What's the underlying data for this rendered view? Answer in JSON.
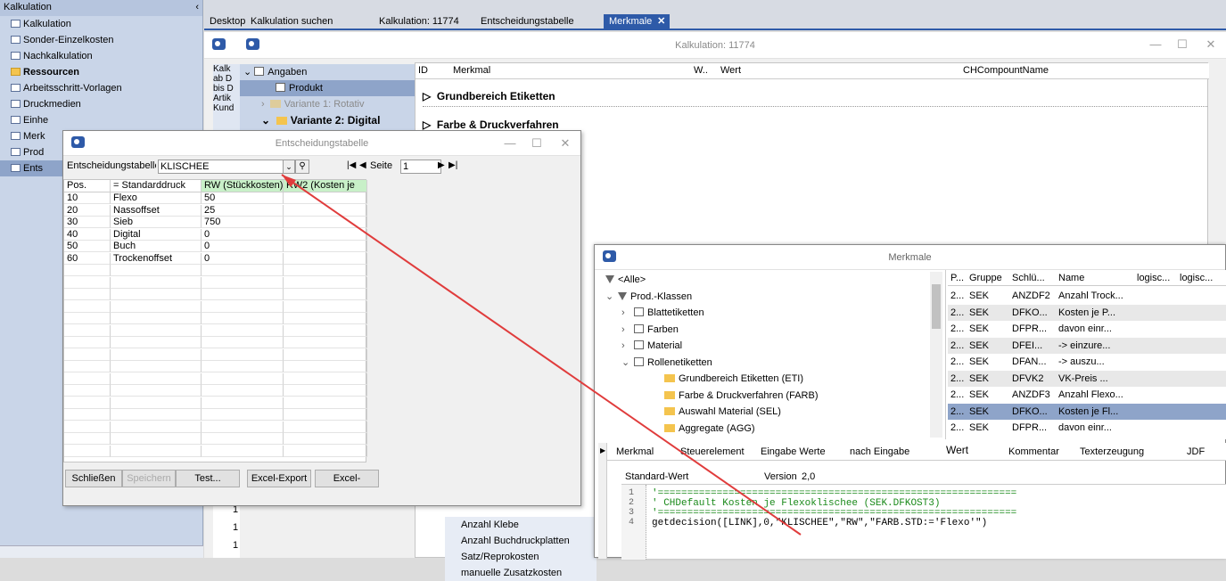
{
  "nav": {
    "title": "Kalkulation",
    "items": [
      {
        "label": "Kalkulation",
        "kind": "doc"
      },
      {
        "label": "Sonder-Einzelkosten",
        "kind": "doc"
      },
      {
        "label": "Nachkalkulation",
        "kind": "doc"
      },
      {
        "label": "Ressourcen",
        "kind": "folder"
      },
      {
        "label": "Arbeitsschritt-Vorlagen",
        "kind": "doc"
      },
      {
        "label": "Druckmedien",
        "kind": "doc"
      },
      {
        "label": "Einhe",
        "kind": "doc"
      },
      {
        "label": "Merk",
        "kind": "doc"
      },
      {
        "label": "Prod",
        "kind": "doc"
      },
      {
        "label": "Ents",
        "kind": "doc"
      }
    ]
  },
  "tabs": [
    "Desktop",
    "Kalkulation suchen",
    "Kalkulation: 11774",
    "Entscheidungstabelle",
    "Merkmale"
  ],
  "main": {
    "title": "Kalkulation: 11774",
    "left_texts": [
      "Kalk",
      "ab D",
      "bis D",
      "Artik",
      "Kund"
    ],
    "tree": [
      "Angaben",
      "Produkt",
      "Variante 1: Rotativ",
      "Variante 2: Digital"
    ],
    "cols": [
      "ID",
      "Merkmal",
      "W..",
      "Wert",
      "CHCompountName"
    ],
    "groups": [
      "Grundbereich Etiketten",
      "Farbe & Druckverfahren"
    ],
    "bottom_numbers": [
      "1",
      "1",
      "1"
    ],
    "bottom_items": [
      "Anzahl Klebe",
      "Anzahl Buchdruckplatten",
      "Satz/Reprokosten",
      "manuelle Zusatzkosten"
    ]
  },
  "et": {
    "title": "Entscheidungstabelle",
    "table_label": "Entscheidungstabelle",
    "table_value": "KLISCHEE",
    "page_label": "Seite",
    "page_value": "1",
    "headers": [
      "Pos.",
      "= Standarddruck",
      "RW (Stückkosten)",
      "RW2 (Kosten je"
    ],
    "rows": [
      [
        "10",
        "Flexo",
        "50"
      ],
      [
        "20",
        "Nassoffset",
        "25"
      ],
      [
        "30",
        "Sieb",
        "750"
      ],
      [
        "40",
        "Digital",
        "0"
      ],
      [
        "50",
        "Buch",
        "0"
      ],
      [
        "60",
        "Trockenoffset",
        "0"
      ]
    ],
    "buttons": [
      "Schließen",
      "Speichern",
      "Test...",
      "Excel-Export",
      "Excel-"
    ]
  },
  "mk": {
    "title": "Merkmale",
    "tree": [
      {
        "label": "<Alle>",
        "icon": "funnel",
        "indent": 0,
        "toggle": ""
      },
      {
        "label": "Prod.-Klassen",
        "icon": "funnel",
        "indent": 0,
        "toggle": "v"
      },
      {
        "label": "Blattetiketten",
        "icon": "list",
        "indent": 1,
        "toggle": ">"
      },
      {
        "label": "Farben",
        "icon": "list",
        "indent": 1,
        "toggle": ">"
      },
      {
        "label": "Material",
        "icon": "list",
        "indent": 1,
        "toggle": ">"
      },
      {
        "label": "Rollenetiketten",
        "icon": "list",
        "indent": 1,
        "toggle": "v"
      },
      {
        "label": "Grundbereich Etiketten (ETI)",
        "icon": "folder",
        "indent": 2,
        "toggle": ""
      },
      {
        "label": "Farbe & Druckverfahren (FARB)",
        "icon": "folder",
        "indent": 2,
        "toggle": ""
      },
      {
        "label": "Auswahl Material (SEL)",
        "icon": "folder",
        "indent": 2,
        "toggle": ""
      },
      {
        "label": "Aggregate (AGG)",
        "icon": "folder",
        "indent": 2,
        "toggle": ""
      }
    ],
    "cols": [
      "P...",
      "Gruppe",
      "Schlü...",
      "Name",
      "logisc...",
      "logisc..."
    ],
    "rows": [
      [
        "2...",
        "SEK",
        "ANZDF2",
        "Anzahl Trock..."
      ],
      [
        "2...",
        "SEK",
        "DFKO...",
        "Kosten je P..."
      ],
      [
        "2...",
        "SEK",
        "DFPR...",
        "davon einr..."
      ],
      [
        "2...",
        "SEK",
        "DFEI...",
        "-> einzure..."
      ],
      [
        "2...",
        "SEK",
        "DFAN...",
        "-> auszu..."
      ],
      [
        "2...",
        "SEK",
        "DFVK2",
        "VK-Preis ..."
      ],
      [
        "2...",
        "SEK",
        "ANZDF3",
        "Anzahl Flexo..."
      ],
      [
        "2...",
        "SEK",
        "DFKO...",
        "Kosten je Fl..."
      ],
      [
        "2...",
        "SEK",
        "DFPR...",
        "davon einr..."
      ]
    ],
    "selected_row": 7,
    "tabs": [
      "Merkmal",
      "Steuerelement",
      "Eingabe Werte",
      "nach Eingabe",
      "Wert",
      "Kommentar",
      "Texterzeugung",
      "JDF"
    ],
    "active_tab": "Wert",
    "std_label": "Standard-Wert",
    "version_label": "Version",
    "version_value": "2,0",
    "code_lines": [
      {
        "n": "1",
        "text": "'============================================================="
      },
      {
        "n": "2",
        "text": "' CHDefault Kosten je Flexoklischee (SEK.DFKOST3)"
      },
      {
        "n": "3",
        "text": "'============================================================="
      },
      {
        "n": "4",
        "text": "getdecision([LINK],0,\"KLISCHEE\",\"RW\",\"FARB.STD:='Flexo'\")"
      }
    ]
  },
  "colors": {
    "accent": "#2e5aa8",
    "arrow": "#e03c3c",
    "selection": "#8ea4c9",
    "green_header": "#c8f0c8"
  }
}
